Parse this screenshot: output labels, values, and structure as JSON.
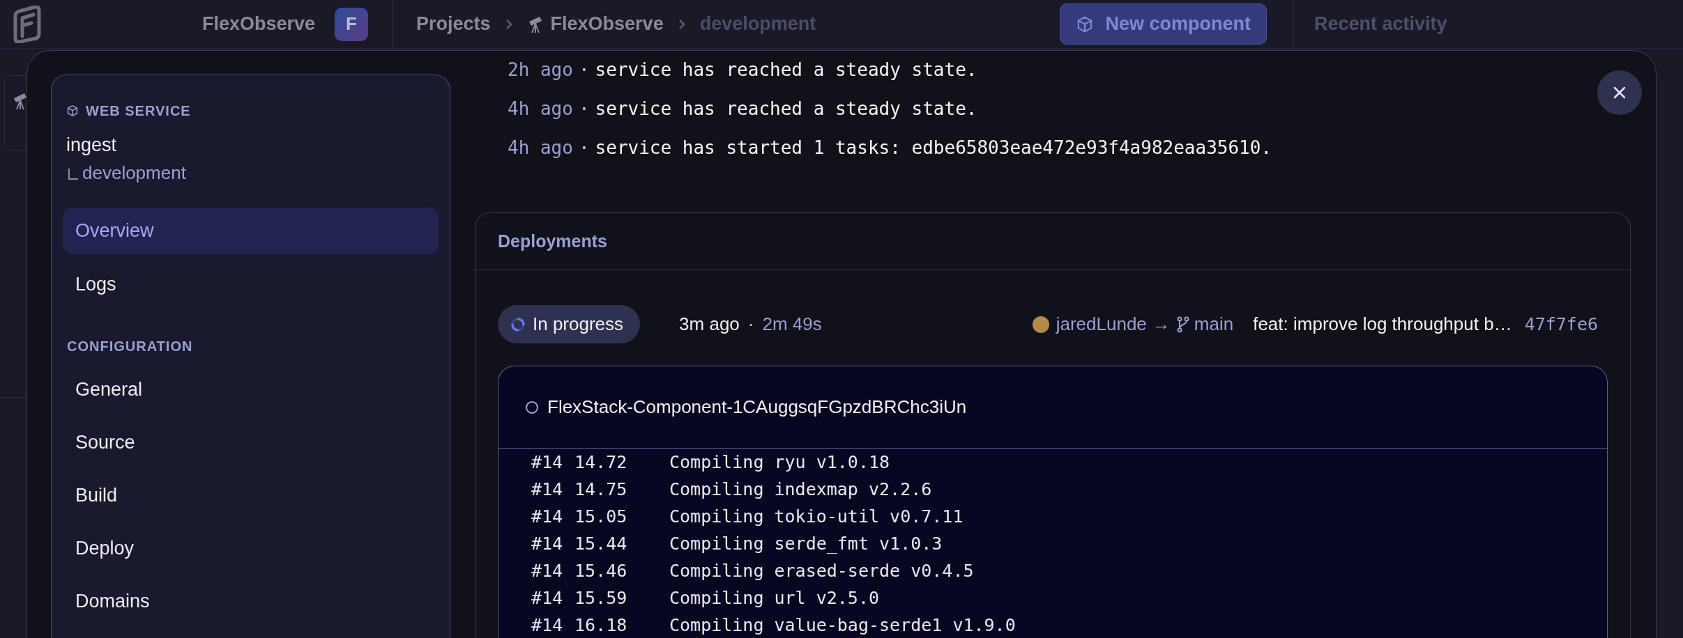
{
  "topbar": {
    "project_name": "FlexObserve",
    "avatar_letter": "F",
    "breadcrumbs": [
      {
        "label": "Projects",
        "kind": "link"
      },
      {
        "label": "FlexObserve",
        "kind": "project"
      },
      {
        "label": "development",
        "kind": "current"
      }
    ],
    "new_button": "New component",
    "recent_activity": "Recent activity"
  },
  "sidebar": {
    "service_type": "WEB SERVICE",
    "service_name": "ingest",
    "environment": "development",
    "sections": [
      {
        "items": [
          {
            "label": "Overview",
            "selected": true
          },
          {
            "label": "Logs",
            "selected": false
          }
        ]
      },
      {
        "heading": "CONFIGURATION",
        "items": [
          {
            "label": "General",
            "selected": false
          },
          {
            "label": "Source",
            "selected": false
          },
          {
            "label": "Build",
            "selected": false
          },
          {
            "label": "Deploy",
            "selected": false
          },
          {
            "label": "Domains",
            "selected": false
          }
        ]
      }
    ]
  },
  "events": [
    {
      "time": "2h ago",
      "separator": "·",
      "message": "service has reached a steady state."
    },
    {
      "time": "4h ago",
      "separator": "·",
      "message": "service has reached a steady state."
    },
    {
      "time": "4h ago",
      "separator": "·",
      "message": "service has started 1 tasks: edbe65803eae472e93f4a982eaa35610."
    }
  ],
  "deployments": {
    "title": "Deployments",
    "deployment": {
      "status": "In progress",
      "in_progress": true,
      "age": "3m ago",
      "separator": "·",
      "duration": "2m 49s",
      "author": "jaredLunde",
      "arrow": "→",
      "branch": "main",
      "commit_message": "feat: improve log throughput b…",
      "commit_hash": "47f7fe6"
    },
    "component": {
      "name": "FlexStack-Component-1CAuggsqFGpzdBRChc3iUn",
      "logs": [
        {
          "step": "#14",
          "time": "14.72",
          "message": "Compiling ryu v1.0.18"
        },
        {
          "step": "#14",
          "time": "14.75",
          "message": "Compiling indexmap v2.2.6"
        },
        {
          "step": "#14",
          "time": "15.05",
          "message": "Compiling tokio-util v0.7.11"
        },
        {
          "step": "#14",
          "time": "15.44",
          "message": "Compiling serde_fmt v1.0.3"
        },
        {
          "step": "#14",
          "time": "15.46",
          "message": "Compiling erased-serde v0.4.5"
        },
        {
          "step": "#14",
          "time": "15.59",
          "message": "Compiling url v2.5.0"
        },
        {
          "step": "#14",
          "time": "16.18",
          "message": "Compiling value-bag-serde1 v1.9.0"
        }
      ]
    }
  }
}
